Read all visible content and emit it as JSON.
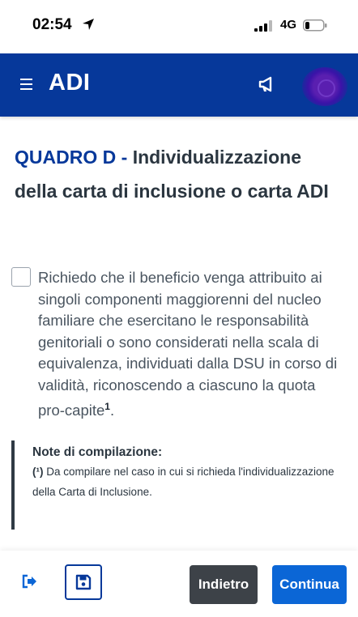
{
  "status_bar": {
    "time": "02:54",
    "network": "4G",
    "icons": [
      "location-arrow-icon",
      "signal-icon",
      "battery-icon"
    ]
  },
  "header": {
    "title": "ADI",
    "icons": [
      "menu-icon",
      "megaphone-icon",
      "avatar"
    ]
  },
  "section": {
    "code": "QUADRO D",
    "separator": " - ",
    "title": "Individualizzazione della carta di inclusione o carta ADI"
  },
  "declaration": {
    "checked": false,
    "text": "Richiedo che il beneficio venga attribuito ai singoli componenti maggiorenni del nucleo familiare che esercitano le responsabilità genitoriali o sono considerati nella scala di equivalenza, individuati dalla DSU in corso di validità, riconoscendo a ciascuno la quota pro-capite",
    "footnote": "1",
    "end": "."
  },
  "note": {
    "title": "Note di compilazione:",
    "marker": "(¹)",
    "text": " Da compilare nel caso in cui si richieda l'individualizzazione della Carta di Inclusione."
  },
  "actions": {
    "back_label": "Indietro",
    "continue_label": "Continua",
    "icons": [
      "logout-icon",
      "save-icon"
    ]
  },
  "colors": {
    "header_bg": "#06389a",
    "title_accent": "#06389a",
    "back_bg": "#3d4248",
    "continue_bg": "#0b66d6"
  }
}
